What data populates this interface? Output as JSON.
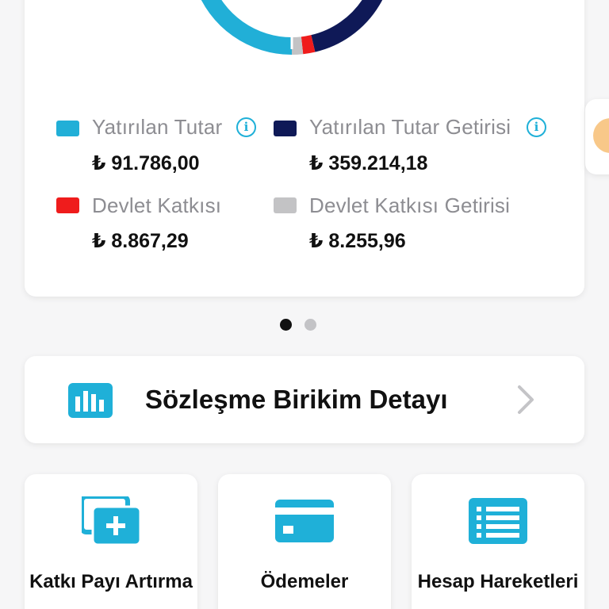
{
  "colors": {
    "accent": "#1fb0d8",
    "yatirilan_tutar": "#21afd7",
    "yatirilan_tutar_getirisi": "#0f1957",
    "devlet_katkisi": "#ef1c1c",
    "devlet_katkisi_getirisi": "#c3c3c5"
  },
  "chart_data": {
    "type": "pie",
    "variant": "donut",
    "slices": [
      {
        "label": "Yatırılan Tutar",
        "value": 91786.0,
        "display": "₺ 91.786,00",
        "color": "#21afd7",
        "has_info": true
      },
      {
        "label": "Yatırılan Tutar Getirisi",
        "value": 359214.18,
        "display": "₺ 359.214,18",
        "color": "#0f1957",
        "has_info": true
      },
      {
        "label": "Devlet Katkısı",
        "value": 8867.29,
        "display": "₺ 8.867,29",
        "color": "#ef1c1c",
        "has_info": false
      },
      {
        "label": "Devlet Katkısı Getirisi",
        "value": 8255.96,
        "display": "₺ 8.255,96",
        "color": "#c3c3c5",
        "has_info": false
      }
    ]
  },
  "pagination": {
    "count": 2,
    "active_index": 0
  },
  "detail": {
    "title": "Sözleşme Birikim Detayı",
    "icon": "bar-chart-icon"
  },
  "tiles": [
    {
      "label": "Katkı Payı Artırma",
      "icon": "add-card-icon"
    },
    {
      "label": "Ödemeler",
      "icon": "credit-card-icon"
    },
    {
      "label": "Hesap Hareketleri",
      "icon": "list-icon"
    }
  ]
}
